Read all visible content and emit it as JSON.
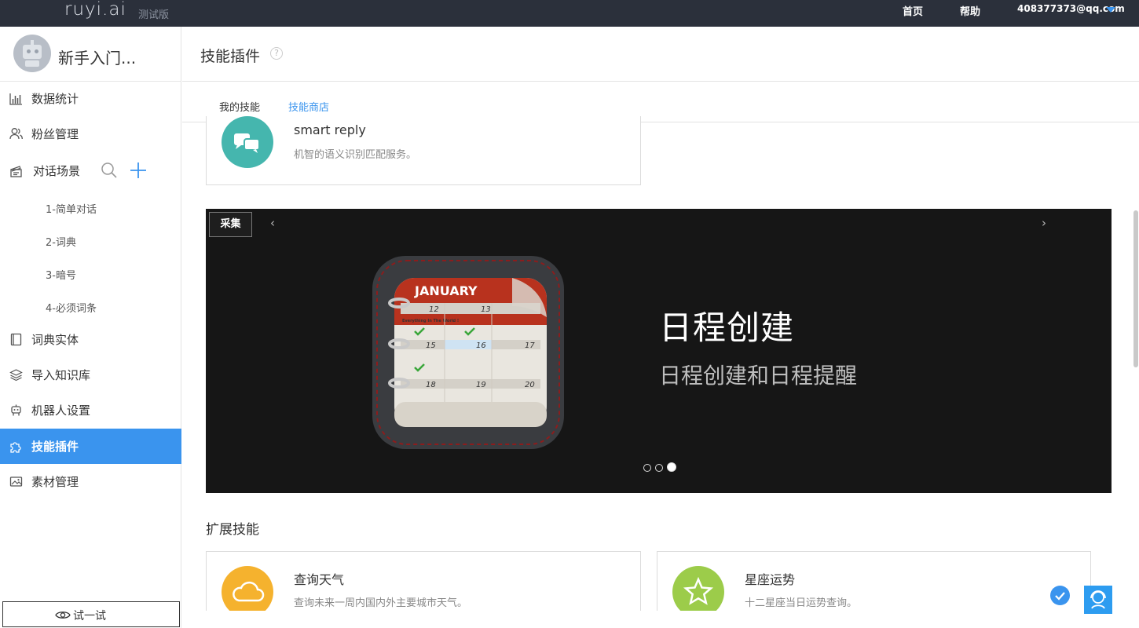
{
  "topbar": {
    "logo": "ruyi.ai",
    "logo_tag": "测试版",
    "links": [
      "首页",
      "帮助"
    ],
    "user": "408377373@qq.com"
  },
  "sidebar": {
    "bot_name": "新手入门...",
    "items": [
      {
        "label": "数据统计",
        "icon": "bar-chart-icon"
      },
      {
        "label": "粉丝管理",
        "icon": "users-icon"
      },
      {
        "label": "对话场景",
        "icon": "clapper-icon"
      },
      {
        "label": "词典实体",
        "icon": "book-icon"
      },
      {
        "label": "导入知识库",
        "icon": "layers-icon"
      },
      {
        "label": "机器人设置",
        "icon": "robot-icon"
      },
      {
        "label": "技能插件",
        "icon": "puzzle-icon",
        "active": true
      },
      {
        "label": "素材管理",
        "icon": "image-icon"
      }
    ],
    "scenes": [
      "1-简单对话",
      "2-词典",
      "3-暗号",
      "4-必须词条"
    ],
    "try_button": "试一试"
  },
  "main": {
    "title": "技能插件",
    "tabs": [
      {
        "label": "我的技能",
        "active": false
      },
      {
        "label": "技能商店",
        "active": true
      }
    ],
    "top_card": {
      "title": "smart reply",
      "desc": "机智的语义识别匹配服务。",
      "icon": "chat-bubbles-icon",
      "color": "#45b6ae"
    },
    "banner": {
      "collect_label": "采集",
      "title": "日程创建",
      "subtitle": "日程创建和日程提醒",
      "calendar_month": "JANUARY",
      "calendar_days": [
        "12",
        "13",
        "15",
        "16",
        "17",
        "18",
        "19",
        "20"
      ],
      "calendar_note": "Everything In The World !",
      "slides": 3,
      "active_slide": 3
    },
    "section_title": "扩展技能",
    "skills": [
      {
        "title": "查询天气",
        "desc": "查询未来一周内国内外主要城市天气。",
        "icon": "cloud-icon",
        "color": "#f5b22e"
      },
      {
        "title": "星座运势",
        "desc": "十二星座当日运势查询。",
        "icon": "star-icon",
        "color": "#9ccc4a"
      }
    ]
  }
}
